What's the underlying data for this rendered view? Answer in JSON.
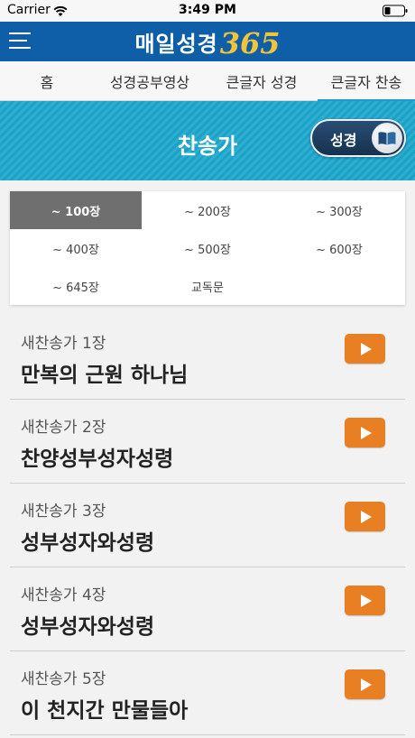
{
  "status_bar": {
    "carrier": "Carrier",
    "time": "3:49 PM"
  },
  "header": {
    "brand_text": "매일성경",
    "brand_number": "365"
  },
  "tabs": [
    {
      "label": "홈"
    },
    {
      "label": "성경공부영상"
    },
    {
      "label": "큰글자 성경"
    },
    {
      "label": "큰글자 찬송",
      "active": true
    }
  ],
  "banner": {
    "title": "찬송가",
    "toggle_label": "성경"
  },
  "ranges": [
    {
      "label": "~ 100장",
      "active": true
    },
    {
      "label": "~ 200장"
    },
    {
      "label": "~ 300장"
    },
    {
      "label": "~ 400장"
    },
    {
      "label": "~ 500장"
    },
    {
      "label": "~ 600장"
    },
    {
      "label": "~ 645장"
    },
    {
      "label": "교독문"
    }
  ],
  "hymns": [
    {
      "number": "새찬송가 1장",
      "title": "만복의 근원 하나님"
    },
    {
      "number": "새찬송가 2장",
      "title": "찬양성부성자성령"
    },
    {
      "number": "새찬송가 3장",
      "title": "성부성자와성령"
    },
    {
      "number": "새찬송가 4장",
      "title": "성부성자와성령"
    },
    {
      "number": "새찬송가 5장",
      "title": "이 천지간 만물들아"
    }
  ],
  "colors": {
    "header": "#0f5fa8",
    "banner": "#1ea9cf",
    "play_button": "#e87f22",
    "active_range": "#6f6f6f"
  },
  "icons": {
    "menu": "hamburger-icon",
    "wifi": "wifi-icon",
    "battery": "battery-icon",
    "book": "book-icon",
    "play": "play-icon"
  }
}
